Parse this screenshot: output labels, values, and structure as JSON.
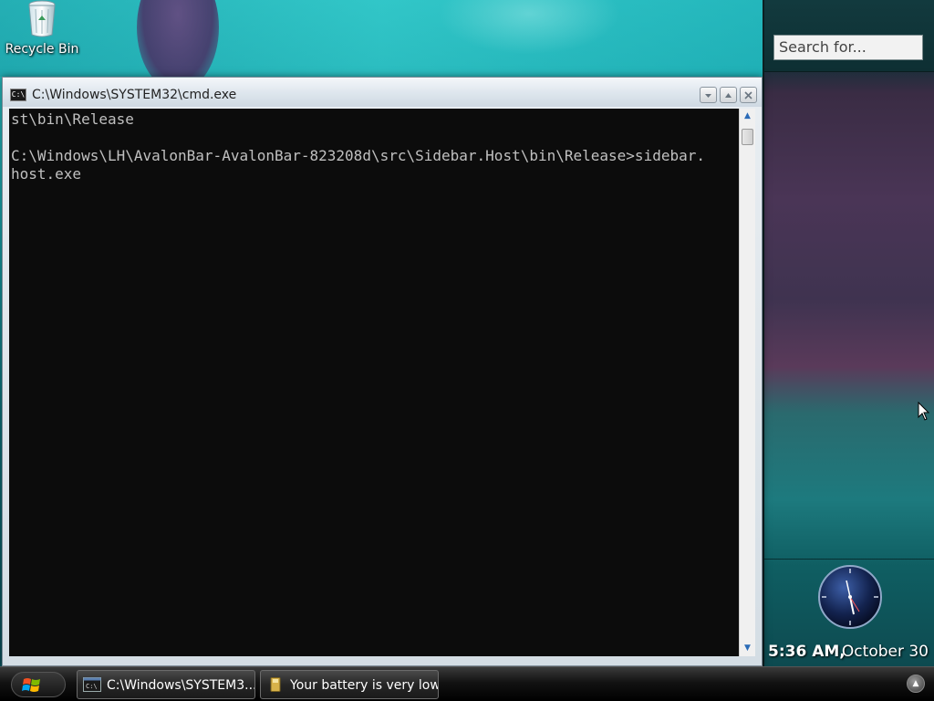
{
  "desktop": {
    "recycle_bin_label": "Recycle Bin"
  },
  "sidebar": {
    "search_placeholder": "Search for...",
    "time": "5:36 AM,",
    "date": "October 30",
    "clock_icon": "analog-clock-icon"
  },
  "cmd_window": {
    "title": "C:\\Windows\\SYSTEM32\\cmd.exe",
    "icon_text": "C:\\",
    "console_text": "st\\bin\\Release\n\nC:\\Windows\\LH\\AvalonBar-AvalonBar-823208d\\src\\Sidebar.Host\\bin\\Release>sidebar.\nhost.exe",
    "buttons": {
      "minimize": "minimize-icon",
      "maximize": "maximize-icon",
      "close": "close-icon"
    }
  },
  "taskbar": {
    "start_icon": "windows-logo-icon",
    "tasks": [
      {
        "label": "C:\\Windows\\SYSTEM3...",
        "icon": "cmd-icon"
      },
      {
        "label": "Your battery is very low",
        "icon": "battery-icon"
      }
    ],
    "tray_button": "show-hidden-icons"
  },
  "colors": {
    "console_bg": "#0c0c0c",
    "console_fg": "#c0c0c0",
    "taskbar_bg": "#121212",
    "wallpaper_teal": "#19a5ac"
  }
}
